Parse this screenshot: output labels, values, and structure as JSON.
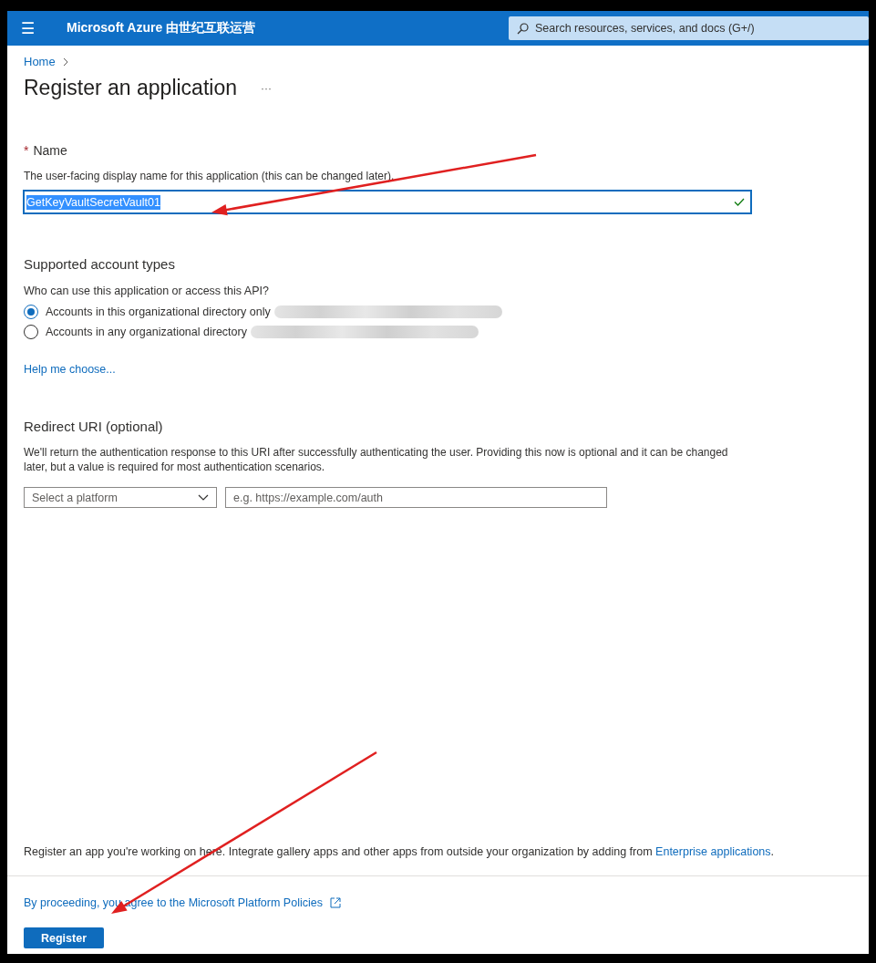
{
  "header": {
    "menu_label": "☰",
    "brand": "Microsoft Azure 由世纪互联运营",
    "search": {
      "placeholder": "Search resources, services, and docs (G+/)"
    }
  },
  "breadcrumb": [
    {
      "label": "Home"
    }
  ],
  "page": {
    "title": "Register an application",
    "more": "···"
  },
  "name_section": {
    "required_mark": "*",
    "label": "Name",
    "description": "The user-facing display name for this application (this can be changed later).",
    "value": "GetKeyVaultSecretVault01",
    "value_selected": true,
    "valid": true
  },
  "account_types": {
    "heading": "Supported account types",
    "question": "Who can use this application or access this API?",
    "options": [
      {
        "label": "Accounts in this organizational directory only",
        "selected": true,
        "redacted": true
      },
      {
        "label": "Accounts in any organizational directory",
        "selected": false,
        "redacted": true
      }
    ],
    "help_link": "Help me choose..."
  },
  "redirect": {
    "heading": "Redirect URI (optional)",
    "description": "We'll return the authentication response to this URI after successfully authenticating the user. Providing this now is optional and it can be changed later, but a value is required for most authentication scenarios.",
    "platform_placeholder": "Select a platform",
    "uri_placeholder": "e.g. https://example.com/auth"
  },
  "footer": {
    "info": "Register an app you're working on here. Integrate gallery apps and other apps from outside your organization by adding from",
    "info_link": "Enterprise applications",
    "info_end": ".",
    "policies_link": "By proceeding, you agree to the Microsoft Platform Policies",
    "register_button": "Register"
  }
}
